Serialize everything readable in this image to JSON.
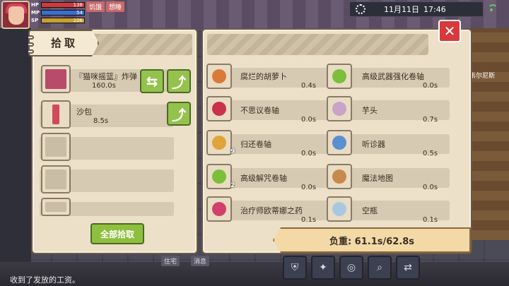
{
  "hud": {
    "hp_label": "HP",
    "hp_value": "138",
    "mp_label": "MP",
    "mp_value": "54",
    "sp_label": "SP",
    "sp_value": "106",
    "tags": [
      "饥饿",
      "想睡"
    ]
  },
  "clock": {
    "date": "11月11日",
    "time": "17:46"
  },
  "npc_name": "韦尔尼斯",
  "left_panel": {
    "title": "拾取",
    "slots": [
      {
        "name": "『猫咪摇篮』炸弹",
        "time": "160.0s",
        "swap_label": "⇆",
        "pick_label": "⤴"
      },
      {
        "name": "沙包",
        "time": "8.5s",
        "pick_label": "⤴"
      },
      {
        "name": "",
        "time": ""
      },
      {
        "name": "",
        "time": ""
      },
      {
        "name": "",
        "time": ""
      }
    ],
    "pick_all_label": "全部拾取"
  },
  "right_panel": {
    "items": [
      {
        "name": "腐烂的胡萝卜",
        "time": "0.4s",
        "badge": "",
        "color": "#d97a3a"
      },
      {
        "name": "高级武器强化卷轴",
        "time": "0.0s",
        "badge": "",
        "color": "#7bbf3a"
      },
      {
        "name": "不思议卷轴",
        "time": "0.0s",
        "badge": "",
        "color": "#c8324a"
      },
      {
        "name": "芋头",
        "time": "0.7s",
        "badge": "",
        "color": "#c9a3c8"
      },
      {
        "name": "归还卷轴",
        "time": "0.0s",
        "badge": "9",
        "color": "#e0a43a"
      },
      {
        "name": "听诊器",
        "time": "0.5s",
        "badge": "",
        "color": "#5a8fd0"
      },
      {
        "name": "高级解咒卷轴",
        "time": "0.0s",
        "badge": "2",
        "color": "#7bbf3a"
      },
      {
        "name": "魔法地图",
        "time": "0.0s",
        "badge": "",
        "color": "#c78a4a"
      },
      {
        "name": "治疗师欧蒂娜之药",
        "time": "0.1s",
        "badge": "",
        "color": "#d0406a"
      },
      {
        "name": "空瓶",
        "time": "0.1s",
        "badge": "",
        "color": "#a8c8e0"
      }
    ],
    "weight_label": "负重: 61.1s/62.8s"
  },
  "bottom": {
    "message": "收到了发放的工资。",
    "labels": [
      "住宅",
      "消息"
    ]
  },
  "close_label": "✕"
}
